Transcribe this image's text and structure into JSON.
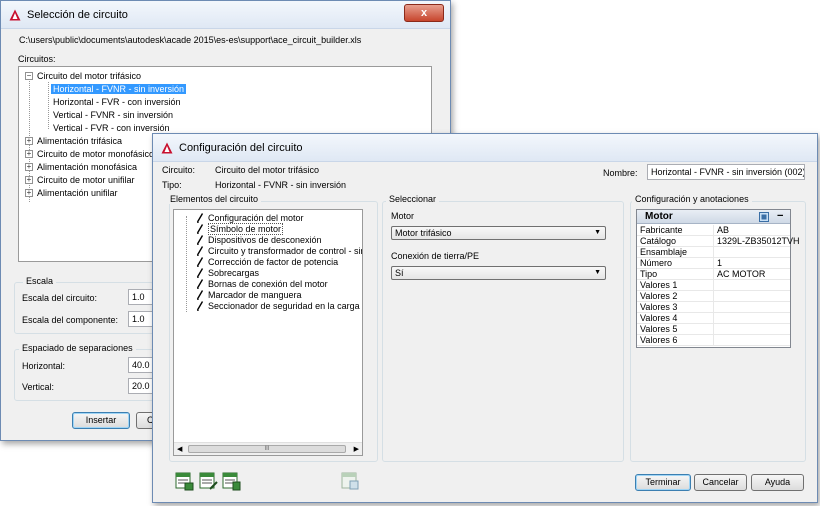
{
  "colors": {
    "selection": "#3399ff",
    "close_button": "#c7452d",
    "titlebar": "#dfe8f4",
    "autocad_red": "#c8102e",
    "icon_green": "#3a8a3a"
  },
  "back_window": {
    "title": "Selección de circuito",
    "close_glyph": "x",
    "file_path": "C:\\users\\public\\documents\\autodesk\\acade 2015\\es-es\\support\\ace_circuit_builder.xls",
    "circuits_label": "Circuitos:",
    "tree": {
      "root": "Circuito del motor trifásico",
      "children": [
        "Horizontal - FVNR - sin inversión",
        "Horizontal - FVR - con inversión",
        "Vertical - FVNR - sin inversión",
        "Vertical - FVR - con inversión"
      ],
      "siblings": [
        "Alimentación trifásica",
        "Circuito de motor monofásico",
        "Alimentación monofásica",
        "Circuito de motor unifilar",
        "Alimentación unifilar"
      ]
    },
    "scale": {
      "title": "Escala",
      "circuit_label": "Escala del circuito:",
      "circuit_value": "1.0",
      "component_label": "Escala del componente:",
      "component_value": "1.0"
    },
    "spacing": {
      "title": "Espaciado de separaciones",
      "horizontal_label": "Horizontal:",
      "horizontal_value": "40.0",
      "vertical_label": "Vertical:",
      "vertical_value": "20.0"
    },
    "insert_button": "Insertar",
    "partial_button": "C"
  },
  "front_window": {
    "title": "Configuración del circuito",
    "circuit_label": "Circuito:",
    "circuit_value": "Circuito del motor trifásico",
    "type_label": "Tipo:",
    "type_value": "Horizontal - FVNR - sin inversión",
    "name_label": "Nombre:",
    "name_value": "Horizontal - FVNR - sin inversión (002)",
    "elements_title": "Elementos del circuito",
    "elements": [
      "Configuración del motor",
      "Símbolo de motor",
      "Dispositivos de desconexión",
      "Circuito y transformador de control - sin inversión",
      "Corrección de factor de potencia",
      "Sobrecargas",
      "Bornas de conexión del motor",
      "Marcador de manguera",
      "Seccionador de seguridad en la carga"
    ],
    "scroll_thumb": "III",
    "select_title": "Seleccionar",
    "motor_label": "Motor",
    "motor_value": "Motor trifásico",
    "ground_label": "Conexión de tierra/PE",
    "ground_value": "Sí",
    "config_title": "Configuración y anotaciones",
    "grid_header": "Motor",
    "grid_collapse": "−",
    "properties": [
      {
        "key": "Fabricante",
        "value": "AB"
      },
      {
        "key": "Catálogo",
        "value": "1329L-ZB35012TVH"
      },
      {
        "key": "Ensamblaje",
        "value": ""
      },
      {
        "key": "Número",
        "value": "1"
      },
      {
        "key": "Tipo",
        "value": "AC MOTOR"
      },
      {
        "key": "Valores 1",
        "value": ""
      },
      {
        "key": "Valores 2",
        "value": ""
      },
      {
        "key": "Valores 3",
        "value": ""
      },
      {
        "key": "Valores 4",
        "value": ""
      },
      {
        "key": "Valores 5",
        "value": ""
      },
      {
        "key": "Valores 6",
        "value": ""
      }
    ],
    "buttons": {
      "finish": "Terminar",
      "cancel": "Cancelar",
      "help": "Ayuda"
    }
  }
}
